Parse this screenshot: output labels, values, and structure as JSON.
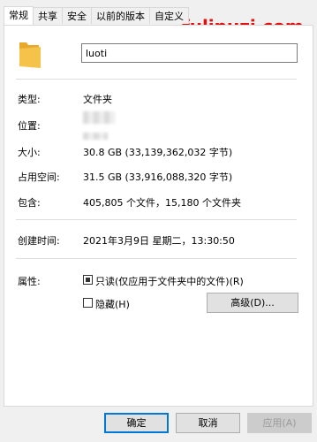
{
  "tabs": [
    "常规",
    "共享",
    "安全",
    "以前的版本",
    "自定义"
  ],
  "watermark": "fulipuzi.com",
  "folder": {
    "name": "luoti",
    "icon": "folder-icon",
    "color": "#f6c34a"
  },
  "props": {
    "type_label": "类型:",
    "type_value": "文件夹",
    "location_label": "位置:",
    "size_label": "大小:",
    "size_value": "30.8 GB (33,139,362,032 字节)",
    "disk_label": "占用空间:",
    "disk_value": "31.5 GB (33,916,088,320 字节)",
    "contains_label": "包含:",
    "contains_value": "405,805 个文件，15,180 个文件夹",
    "created_label": "创建时间:",
    "created_value": "2021年3月9日 星期二，13:30:50",
    "attr_label": "属性:",
    "readonly_label": "只读(仅应用于文件夹中的文件)(R)",
    "hidden_label": "隐藏(H)",
    "advanced_label": "高级(D)..."
  },
  "buttons": {
    "ok": "确定",
    "cancel": "取消",
    "apply": "应用(A)"
  },
  "colors": {
    "watermark": "#e01010",
    "primary_border": "#0078d7"
  }
}
